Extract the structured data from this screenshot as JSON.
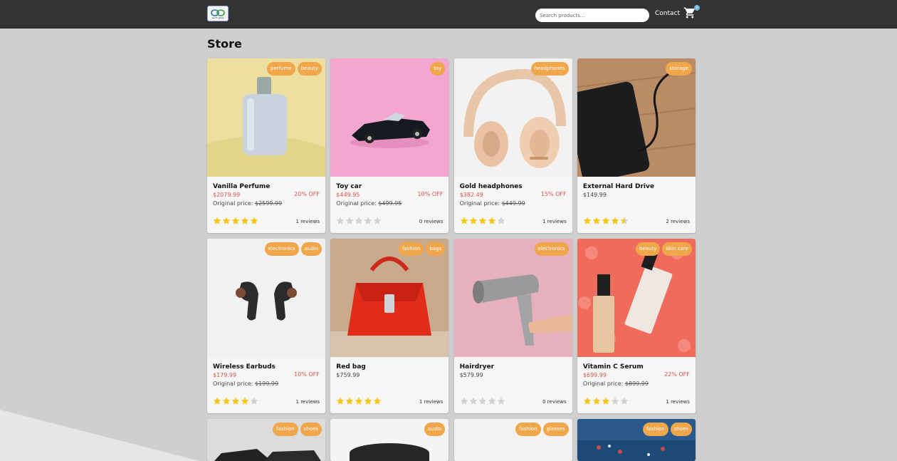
{
  "header": {
    "logo_text": "earth glass",
    "search_placeholder": "Search products...",
    "contact_label": "Contact",
    "cart_count": "0"
  },
  "page_title": "Store",
  "labels": {
    "original_price": "Original price:",
    "reviews_suffix": "reviews"
  },
  "products": [
    {
      "name": "Vanilla Perfume",
      "price": "$2079.99",
      "discount": "20% OFF",
      "original": "$2599.99",
      "rating": 5,
      "reviews": "1 reviews",
      "tags": [
        "perfume",
        "beauty"
      ],
      "image": "perfume"
    },
    {
      "name": "Toy car",
      "price": "$449.95",
      "discount": "10% OFF",
      "original": "$499.95",
      "rating": 0,
      "reviews": "0 reviews",
      "tags": [
        "toy"
      ],
      "image": "toy-car"
    },
    {
      "name": "Gold headphones",
      "price": "$382.49",
      "discount": "15% OFF",
      "original": "$449.99",
      "rating": 4,
      "reviews": "1 reviews",
      "tags": [
        "headphones"
      ],
      "image": "headphones"
    },
    {
      "name": "External Hard Drive",
      "price": "$149.99",
      "discount": "",
      "original": "",
      "rating": 4.5,
      "reviews": "2 reviews",
      "tags": [
        "storage"
      ],
      "image": "hard-drive"
    },
    {
      "name": "Wireless Earbuds",
      "price": "$179.99",
      "discount": "10% OFF",
      "original": "$199.99",
      "rating": 4,
      "reviews": "1 reviews",
      "tags": [
        "electronics",
        "audio"
      ],
      "image": "earbuds"
    },
    {
      "name": "Red bag",
      "price": "$759.99",
      "discount": "",
      "original": "",
      "rating": 5,
      "reviews": "1 reviews",
      "tags": [
        "fashion",
        "bags"
      ],
      "image": "red-bag"
    },
    {
      "name": "Hairdryer",
      "price": "$579.99",
      "discount": "",
      "original": "",
      "rating": 0,
      "reviews": "0 reviews",
      "tags": [
        "electronics"
      ],
      "image": "hairdryer"
    },
    {
      "name": "Vitamin C Serum",
      "price": "$699.99",
      "discount": "22% OFF",
      "original": "$899.99",
      "rating": 3,
      "reviews": "1 reviews",
      "tags": [
        "beauty",
        "skin care"
      ],
      "image": "serum"
    }
  ],
  "partial_products": [
    {
      "tags": [
        "fashion",
        "shoes"
      ],
      "image": "shoes-dark"
    },
    {
      "tags": [
        "audio"
      ],
      "image": "speaker"
    },
    {
      "tags": [
        "fashion",
        "glasses"
      ],
      "image": "glasses"
    },
    {
      "tags": [
        "fashion",
        "shoes"
      ],
      "image": "shoes-blue"
    }
  ],
  "colors": {
    "header_bg": "#333333",
    "tag_bg": "#f0a64a",
    "discount": "#d9534f",
    "star": "#f5c518",
    "star_empty": "#d0d0d0",
    "cart_badge": "#6ab3d8"
  }
}
